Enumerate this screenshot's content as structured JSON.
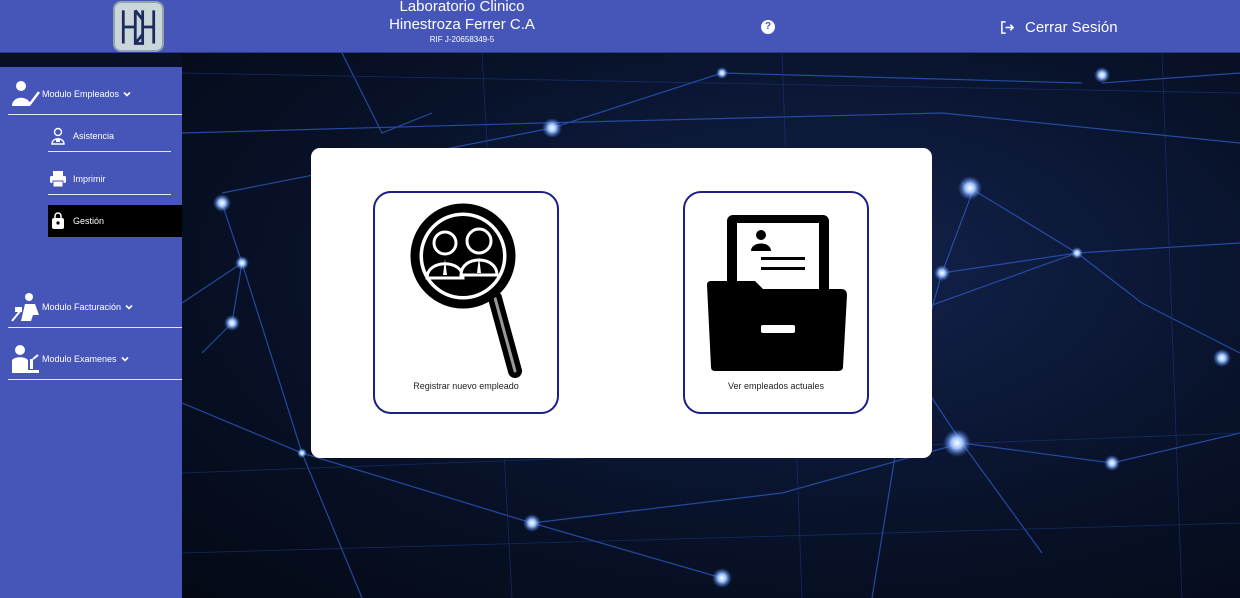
{
  "header": {
    "brand_line1": "Laboratorio Clinico",
    "brand_line2": "Hinestroza Ferrer C.A",
    "brand_line3": "RIF J-20658349-5",
    "help_icon": "question-circle-icon",
    "logout_label": "Cerrar Sesión",
    "logout_icon": "sign-out-icon",
    "color": "#4655b8"
  },
  "sidebar": {
    "modules": [
      {
        "label": "Modulo Empleados",
        "icon": "employee-check-icon",
        "expanded": true
      },
      {
        "label": "Modulo Facturación",
        "icon": "billing-person-icon",
        "expanded": false
      },
      {
        "label": "Modulo Examenes",
        "icon": "lab-technician-icon",
        "expanded": false
      }
    ],
    "items": [
      {
        "label": "Asistencia",
        "icon": "user-badge-icon",
        "active": false
      },
      {
        "label": "Imprimir",
        "icon": "printer-icon",
        "active": false
      },
      {
        "label": "Gestión",
        "icon": "lock-bag-icon",
        "active": true
      }
    ]
  },
  "main": {
    "tiles": [
      {
        "label": "Registrar nuevo empleado",
        "icon": "magnifier-people-icon"
      },
      {
        "label": "Ver empleados actuales",
        "icon": "folder-document-icon"
      }
    ]
  }
}
